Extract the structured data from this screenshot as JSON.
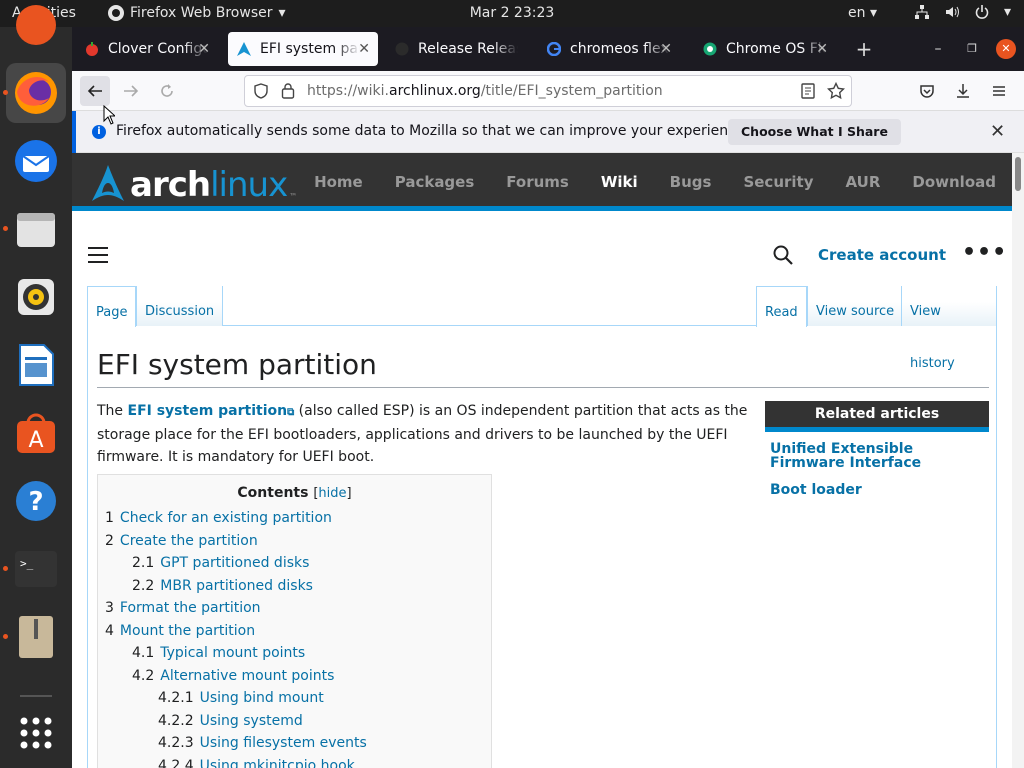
{
  "topbar": {
    "activities": "Activities",
    "app_name": "Firefox Web Browser",
    "clock": "Mar 2  23:23",
    "lang": "en"
  },
  "dock": {
    "items": [
      "Ubuntu Software (partial)",
      "Firefox",
      "Thunderbird",
      "Files",
      "Rhythmbox",
      "LibreOffice Writer",
      "Ubuntu Software",
      "Help",
      "Terminal",
      "Archive Manager",
      "Show Applications"
    ]
  },
  "browser": {
    "tabs": [
      {
        "title": "Clover Configu",
        "icon": "tomato-icon"
      },
      {
        "title": "EFI system par",
        "icon": "arch-icon",
        "active": true
      },
      {
        "title": "Release Releas",
        "icon": "github-icon"
      },
      {
        "title": "chromeos flex",
        "icon": "google-icon"
      },
      {
        "title": "Chrome OS Fle",
        "icon": "chrome-icon"
      }
    ],
    "url_prefix": "https://wiki.",
    "url_domain": "archlinux.org",
    "url_path": "/title/EFI_system_partition",
    "notification": "Firefox automatically sends some data to Mozilla so that we can improve your experience.",
    "notification_button": "Choose What I Share"
  },
  "arch": {
    "logo_arch": "arch",
    "logo_linux": "linux",
    "logo_tm": "™",
    "nav": [
      "Home",
      "Packages",
      "Forums",
      "Wiki",
      "Bugs",
      "Security",
      "AUR",
      "Download"
    ],
    "nav_current": "Wiki"
  },
  "wiki": {
    "create_account": "Create account",
    "more": "•••",
    "tabs_left": [
      "Page",
      "Discussion"
    ],
    "tabs_right": [
      "Read",
      "View source",
      "View history"
    ],
    "title": "EFI system partition",
    "intro_before": "The ",
    "intro_link": "EFI system partition",
    "intro_after": " (also called ESP) is an OS independent partition that acts as the storage place for the EFI bootloaders, applications and drivers to be launched by the UEFI firmware. It is mandatory for UEFI boot.",
    "related_title": "Related articles",
    "related": [
      "Unified Extensible Firmware Interface",
      "Boot loader"
    ],
    "toc_title": "Contents",
    "toc_hide": "hide",
    "toc": [
      {
        "num": "1",
        "text": "Check for an existing partition",
        "level": 1
      },
      {
        "num": "2",
        "text": "Create the partition",
        "level": 1
      },
      {
        "num": "2.1",
        "text": "GPT partitioned disks",
        "level": 2
      },
      {
        "num": "2.2",
        "text": "MBR partitioned disks",
        "level": 2
      },
      {
        "num": "3",
        "text": "Format the partition",
        "level": 1
      },
      {
        "num": "4",
        "text": "Mount the partition",
        "level": 1
      },
      {
        "num": "4.1",
        "text": "Typical mount points",
        "level": 2
      },
      {
        "num": "4.2",
        "text": "Alternative mount points",
        "level": 2
      },
      {
        "num": "4.2.1",
        "text": "Using bind mount",
        "level": 3
      },
      {
        "num": "4.2.2",
        "text": "Using systemd",
        "level": 3
      },
      {
        "num": "4.2.3",
        "text": "Using filesystem events",
        "level": 3
      },
      {
        "num": "4.2.4",
        "text": "Using mkinitcpio hook",
        "level": 3
      }
    ]
  }
}
